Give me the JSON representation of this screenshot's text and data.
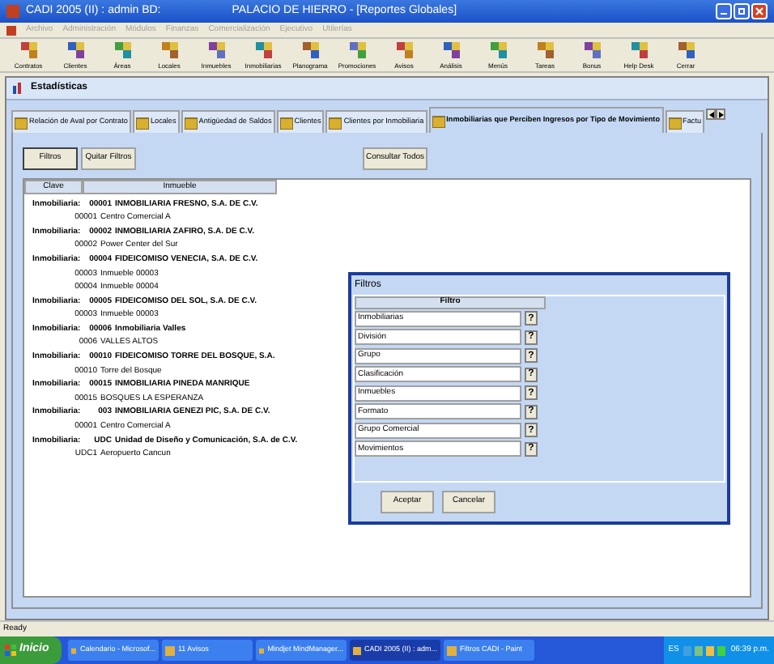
{
  "window": {
    "title": "CADI  2005 (II) : admin   BD:",
    "subtitle": "PALACIO DE HIERRO - [Reportes Globales]"
  },
  "menu": [
    "Archivo",
    "Administración",
    "Módulos",
    "Finanzas",
    "Comercialización",
    "Ejecutivo",
    "Utilerías"
  ],
  "toolbar": [
    "Contratos",
    "Clientes",
    "Áreas",
    "Locales",
    "Inmuebles",
    "Inmobiliarias",
    "Planograma",
    "Promociones",
    "Avisos",
    "Análisis",
    "Menús",
    "Tareas",
    "Bonus",
    "Help Desk",
    "Cerrar"
  ],
  "panel_title": "Estadísticas",
  "tabs": [
    {
      "label": "Relación de Aval por Contrato",
      "selected": false
    },
    {
      "label": "Locales",
      "selected": false
    },
    {
      "label": "Antigüedad de Saldos",
      "selected": false
    },
    {
      "label": "Clientes",
      "selected": false
    },
    {
      "label": "Clientes por Inmobiliaria",
      "selected": false
    },
    {
      "label": "Inmobiliarias que Perciben Ingresos por Tipo de Movimiento",
      "selected": true
    },
    {
      "label": "Factu",
      "selected": false
    }
  ],
  "buttons": [
    "Filtros",
    "Quitar Filtros",
    "Consultar Todos"
  ],
  "table": {
    "columns": [
      "Clave",
      "Inmueble"
    ],
    "rows": [
      {
        "kind": "group",
        "label": "Inmobiliaria:",
        "code": "00001",
        "name": "INMOBILIARIA FRESNO, S.A. DE C.V."
      },
      {
        "kind": "item",
        "code": "00001",
        "name": "Centro Comercial A"
      },
      {
        "kind": "group",
        "label": "Inmobiliaria:",
        "code": "00002",
        "name": "INMOBILIARIA ZAFIRO, S.A. DE C.V."
      },
      {
        "kind": "item",
        "code": "00002",
        "name": "Power Center del Sur"
      },
      {
        "kind": "group",
        "label": "Inmobiliaria:",
        "code": "00004",
        "name": "FIDEICOMISO VENECIA, S.A. DE C.V."
      },
      {
        "kind": "item",
        "code": "00003",
        "name": "Inmueble 00003"
      },
      {
        "kind": "item",
        "code": "00004",
        "name": "Inmueble 00004"
      },
      {
        "kind": "group",
        "label": "Inmobiliaria:",
        "code": "00005",
        "name": "FIDEICOMISO DEL SOL, S.A. DE C.V."
      },
      {
        "kind": "item",
        "code": "00003",
        "name": "Inmueble 00003"
      },
      {
        "kind": "group",
        "label": "Inmobiliaria:",
        "code": "00006",
        "name": "Inmobiliaria Valles"
      },
      {
        "kind": "item",
        "code": "0006",
        "name": "VALLES ALTOS"
      },
      {
        "kind": "group",
        "label": "Inmobiliaria:",
        "code": "00010",
        "name": "FIDEICOMISO TORRE DEL BOSQUE, S.A."
      },
      {
        "kind": "item",
        "code": "00010",
        "name": "Torre del Bosque"
      },
      {
        "kind": "group",
        "label": "Inmobiliaria:",
        "code": "00015",
        "name": "INMOBILIARIA PINEDA MANRIQUE"
      },
      {
        "kind": "item",
        "code": "00015",
        "name": "BOSQUES LA ESPERANZA"
      },
      {
        "kind": "group",
        "label": "Inmobiliaria:",
        "code": "003",
        "name": "INMOBILIARIA GENEZI PIC, S.A. DE C.V."
      },
      {
        "kind": "item",
        "code": "00001",
        "name": "Centro Comercial A"
      },
      {
        "kind": "group",
        "label": "Inmobiliaria:",
        "code": "UDC",
        "name": "Unidad de Diseño y Comunicación, S.A. de C.V."
      },
      {
        "kind": "item",
        "code": "UDC1",
        "name": "Aeropuerto Cancun"
      }
    ]
  },
  "dialog": {
    "title": "Filtros",
    "column": "Filtro",
    "help": "?",
    "filters": [
      "Inmobiliarias",
      "División",
      "Grupo",
      "Clasificación",
      "Inmuebles",
      "Formato",
      "Grupo Comercial",
      "Movimientos"
    ],
    "buttons": [
      "Aceptar",
      "Cancelar"
    ]
  },
  "status_bar": "Ready",
  "taskbar": {
    "start": "Inicio",
    "tasks": [
      {
        "label": "Calendario - Microsof...",
        "selected": false
      },
      {
        "label": "11 Avisos",
        "selected": false
      },
      {
        "label": "Mindjet MindManager...",
        "selected": false
      },
      {
        "label": "CADI  2005 (II) : adm...",
        "selected": true
      },
      {
        "label": "Filtros CADI - Paint",
        "selected": false
      }
    ],
    "language": "ES",
    "clock": "06:39 p.m."
  }
}
